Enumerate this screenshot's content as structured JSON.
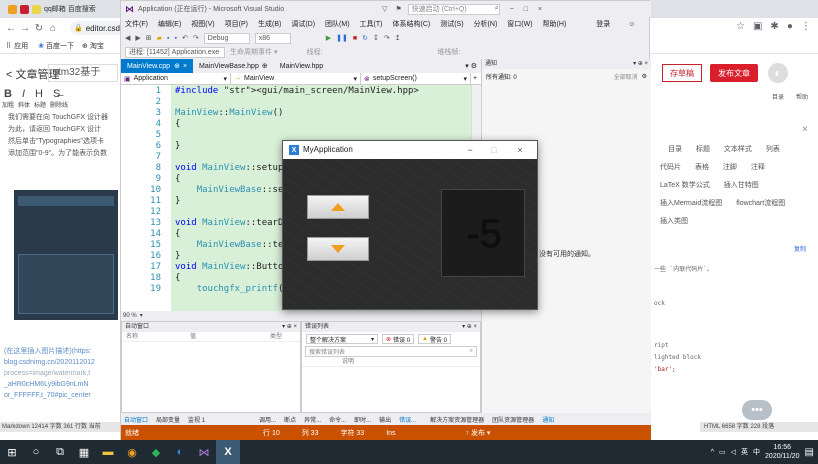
{
  "chrome": {
    "tabs": [
      {
        "label": "qq邮箱 百度搜索",
        "color": "#f0a020"
      },
      {
        "label": "",
        "color": "#c8202f"
      }
    ],
    "url": "editor.csdn",
    "bookmarks": [
      "应用",
      "百度一下",
      "淘宝"
    ]
  },
  "csdn": {
    "back_label": "< 文章管理",
    "title_value": "stm32基于",
    "draft_label": "存草稿",
    "publish_label": "发布文章",
    "toolbar": [
      "加粗",
      "斜体",
      "标题",
      "删除线"
    ],
    "body_lines": [
      "我们需要在向 TouchGFX 设计器",
      "为此，请返回 TouchGFX 设计",
      "然后单击\"Typographies\"选项卡",
      "添加范围\"0-9\"。为了能表示负数"
    ],
    "link_lines": [
      "(在这里插入图片描述)(https:",
      "blog.csdnimg.cn/2020112012",
      "process=image/watermark,t",
      "_aHR0cHM6Ly9ibG9nLmN",
      "or_FFFFFF,t_70#pic_center"
    ],
    "right_toolbar": [
      "目录",
      "帮助"
    ],
    "right_tags": [
      "目录",
      "标题",
      "文本样式",
      "列表",
      "代码片",
      "表格",
      "注脚",
      "注释",
      "LaTeX 数学公式",
      "插入甘特图",
      "插入Mermaid流程图",
      "flowchart流程图",
      "插入类图"
    ],
    "right_code_lines": [
      "一些 `内联代码片`。",
      "ock",
      "ript",
      "lighted block",
      "'bar';"
    ],
    "copy_label": "复制",
    "status_left": "Markdown 12414 字数 361 行数 当前",
    "status_right": "HTML 6658 字数 228 段落"
  },
  "vs": {
    "title": "Application (正在运行) - Microsoft Visual Studio",
    "quick_launch": "快速启动 (Ctrl+Q)",
    "signin": "登录",
    "menu": [
      "文件(F)",
      "编辑(E)",
      "视图(V)",
      "项目(P)",
      "生成(B)",
      "调试(D)",
      "团队(M)",
      "工具(T)",
      "体系结构(C)",
      "测试(S)",
      "分析(N)",
      "窗口(W)",
      "帮助(H)"
    ],
    "config": "Debug",
    "platform": "x86",
    "process": "进程: [11452] Application.exe",
    "lifecycle": "生命周期事件 ▾",
    "thread": "线程:",
    "stack": "堆栈帧:",
    "doc_tabs": [
      {
        "label": "MainView.cpp",
        "active": true
      },
      {
        "label": "MainViewBase.hpp",
        "active": false
      },
      {
        "label": "MainView.hpp",
        "active": false
      }
    ],
    "nav_project": "Application",
    "nav_class": "MainView",
    "nav_member": "setupScreen()",
    "code": [
      {
        "n": "1",
        "t": "#include <gui/main_screen/MainView.hpp>"
      },
      {
        "n": "2",
        "t": ""
      },
      {
        "n": "3",
        "t": "MainView::MainView()"
      },
      {
        "n": "4",
        "t": "{"
      },
      {
        "n": "5",
        "t": ""
      },
      {
        "n": "6",
        "t": "}"
      },
      {
        "n": "7",
        "t": ""
      },
      {
        "n": "8",
        "t": "void MainView::setupScreen()"
      },
      {
        "n": "9",
        "t": "{"
      },
      {
        "n": "10",
        "t": "    MainViewBase::setupScreen();"
      },
      {
        "n": "11",
        "t": "}"
      },
      {
        "n": "12",
        "t": ""
      },
      {
        "n": "13",
        "t": "void MainView::tearDownScreen()"
      },
      {
        "n": "14",
        "t": "{"
      },
      {
        "n": "15",
        "t": "    MainViewBase::tearDownScreen();"
      },
      {
        "n": "16",
        "t": "}"
      },
      {
        "n": "17",
        "t": "void MainView::ButtonUpClicked()"
      },
      {
        "n": "18",
        "t": "{"
      },
      {
        "n": "19",
        "t": "    touchgfx_printf(\"buttonUpClicked\\n\");"
      }
    ],
    "zoom": "90 %",
    "autos_title": "自动窗口",
    "autos_cols": [
      "名称",
      "值",
      "类型"
    ],
    "errors_title": "错误列表",
    "errors_scope": "整个解决方案",
    "errors_count": "错误 0",
    "warnings_count": "警告 0",
    "errors_search": "搜索错误列表",
    "errors_col": "说明",
    "notif_title": "通知",
    "notif_all": "所有通知: 0",
    "notif_clear": "全部取消",
    "notif_empty": "没有可用的通知。",
    "bottom_tabs_left": [
      "自动窗口",
      "局部变量",
      "监视 1"
    ],
    "bottom_tabs_mid": [
      "调用...",
      "断点",
      "异常...",
      "命令...",
      "即时...",
      "输出",
      "错误..."
    ],
    "bottom_tabs_right": [
      "解决方案资源管理器",
      "团队资源管理器",
      "通知"
    ],
    "status": {
      "mode": "就绪",
      "line": "行 10",
      "col": "列 33",
      "char": "字符 33",
      "ins": "Ins",
      "publish": "↑ 发布 ▾"
    }
  },
  "myapp": {
    "title": "MyApplication",
    "icon_letter": "X",
    "counter": "-5",
    "accent": "#f0a020"
  },
  "taskbar": {
    "clock_time": "16:56",
    "clock_date": "2020/11/20",
    "ime": "中",
    "lang": "英"
  }
}
